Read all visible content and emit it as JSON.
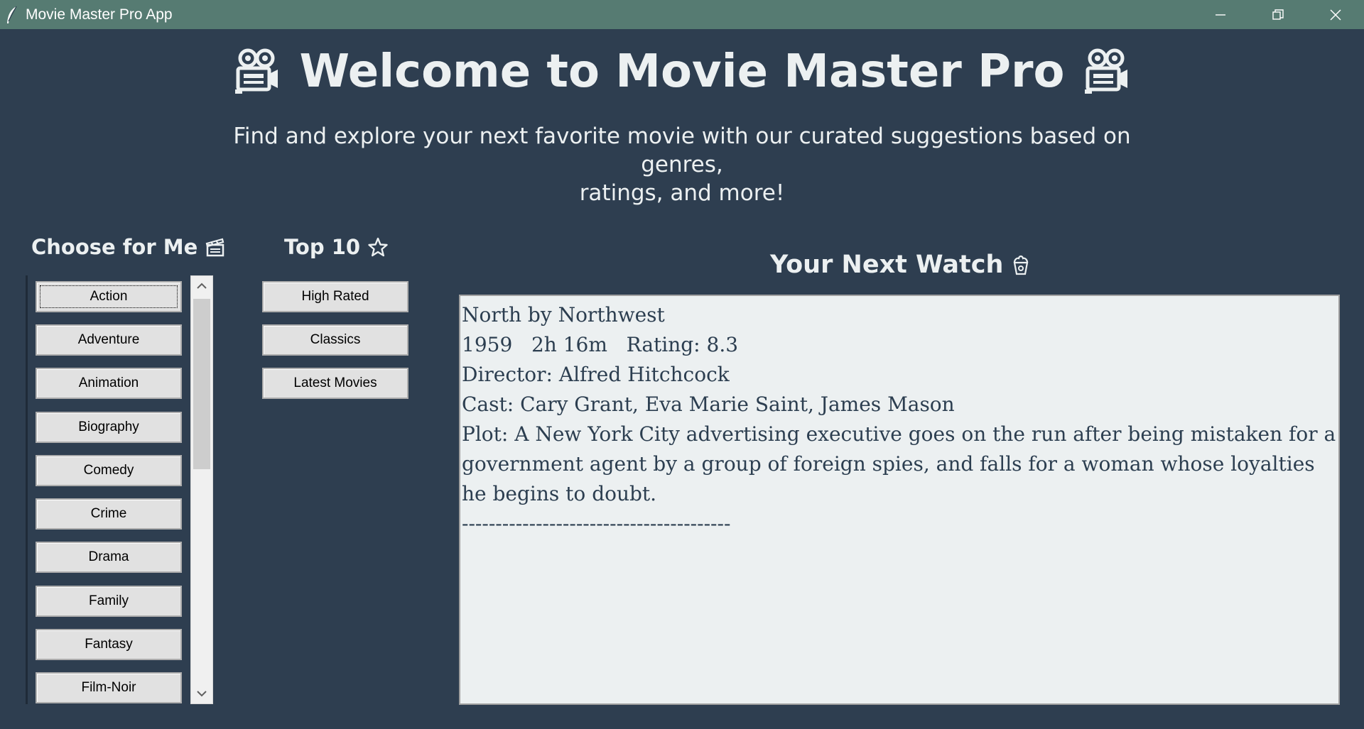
{
  "window": {
    "title": "Movie Master Pro App"
  },
  "header": {
    "welcome": "Welcome to Movie Master Pro",
    "subtitle_line1": "Find and explore your next favorite movie with our curated suggestions based on genres,",
    "subtitle_line2": "ratings, and more!"
  },
  "choose": {
    "title": "Choose for Me",
    "genres": [
      "Action",
      "Adventure",
      "Animation",
      "Biography",
      "Comedy",
      "Crime",
      "Drama",
      "Family",
      "Fantasy",
      "Film-Noir"
    ]
  },
  "top10": {
    "title": "Top 10",
    "buttons": [
      "High Rated",
      "Classics",
      "Latest Movies"
    ]
  },
  "next_watch": {
    "title": "Your Next Watch",
    "movie_title": "North by Northwest",
    "meta": "1959   2h 16m   Rating: 8.3",
    "director": "Director: Alfred Hitchcock",
    "cast": "Cast: Cary Grant, Eva Marie Saint, James Mason",
    "plot": "Plot: A New York City advertising executive goes on the run after being mistaken for a government agent by a group of foreign spies, and falls for a woman whose loyalties he begins to doubt.",
    "separator": "----------------------------------------"
  },
  "colors": {
    "background": "#2e3e50",
    "titlebar": "#567b72",
    "text_light": "#ecf0f1",
    "result_text": "#2c3e50"
  },
  "icons": {
    "header": "movie-camera-icon",
    "choose": "clapperboard-icon",
    "top10": "star-icon",
    "next_watch": "popcorn-icon"
  }
}
